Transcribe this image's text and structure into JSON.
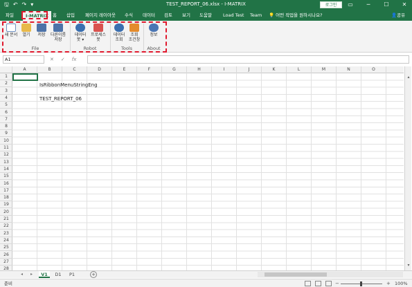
{
  "window": {
    "title": "TEST_REPORT_06.xlsx - I-MATRIX",
    "login_label": "로그인",
    "qat_icons": [
      "save-icon",
      "undo-icon",
      "redo-icon",
      "customize-icon"
    ],
    "controls": [
      "ribbon-display-icon",
      "minimize-icon",
      "maximize-icon",
      "close-icon"
    ]
  },
  "tabs": [
    {
      "label": "파일"
    },
    {
      "label": "I-MATRIX",
      "active": true
    },
    {
      "label": "홈"
    },
    {
      "label": "삽입"
    },
    {
      "label": "페이지 레이아웃"
    },
    {
      "label": "수식"
    },
    {
      "label": "데이터"
    },
    {
      "label": "검토"
    },
    {
      "label": "보기"
    },
    {
      "label": "도움말"
    },
    {
      "label": "Load Test"
    },
    {
      "label": "Team"
    }
  ],
  "tell_me": "어떤 작업을 원하시나요?",
  "share": "공유",
  "ribbon": {
    "groups": [
      {
        "label": "File",
        "buttons": [
          {
            "line1": "새 문서",
            "line2": "",
            "icon": "new-document-icon"
          },
          {
            "line1": "열기",
            "line2": "",
            "icon": "open-folder-icon"
          },
          {
            "line1": "저장",
            "line2": "",
            "icon": "save-icon"
          },
          {
            "line1": "다른이름",
            "line2": "저장",
            "icon": "save-as-icon"
          }
        ]
      },
      {
        "label": "Robot",
        "buttons": [
          {
            "line1": "데이터",
            "line2": "봇 ▾",
            "icon": "data-bot-icon"
          },
          {
            "line1": "프로세스",
            "line2": "봇",
            "icon": "process-bot-icon"
          }
        ]
      },
      {
        "label": "Tools",
        "buttons": [
          {
            "line1": "데이터",
            "line2": "조회",
            "icon": "data-lookup-icon"
          },
          {
            "line1": "조회",
            "line2": "조건창",
            "icon": "lookup-condition-icon"
          }
        ]
      },
      {
        "label": "About",
        "buttons": [
          {
            "line1": "정보",
            "line2": "",
            "icon": "info-gear-icon"
          }
        ]
      }
    ],
    "accent": "#217346",
    "highlight": "#e0182d"
  },
  "formula_bar": {
    "name_box": "A1",
    "cancel": "✕",
    "enter": "✓",
    "fx": "fx",
    "value": ""
  },
  "grid": {
    "columns": [
      "A",
      "B",
      "C",
      "D",
      "E",
      "F",
      "G",
      "H",
      "I",
      "J",
      "K",
      "L",
      "M",
      "N",
      "O"
    ],
    "rows": [
      "1",
      "2",
      "3",
      "4",
      "5",
      "6",
      "7",
      "8",
      "9",
      "10",
      "11",
      "12",
      "13",
      "14",
      "15",
      "16",
      "17",
      "18",
      "19",
      "20",
      "21",
      "22",
      "23",
      "24",
      "25",
      "26",
      "27",
      "28"
    ],
    "selected_cell": "A1",
    "cells": {
      "B2": "IsRibbonMenuStringEng",
      "B4": "TEST_REPORT_06"
    }
  },
  "sheets": [
    {
      "label": "V1",
      "active": true
    },
    {
      "label": "D1"
    },
    {
      "label": "P1"
    }
  ],
  "status": {
    "text": "준비",
    "zoom_minus": "−",
    "zoom_plus": "+",
    "zoom": "100%"
  }
}
